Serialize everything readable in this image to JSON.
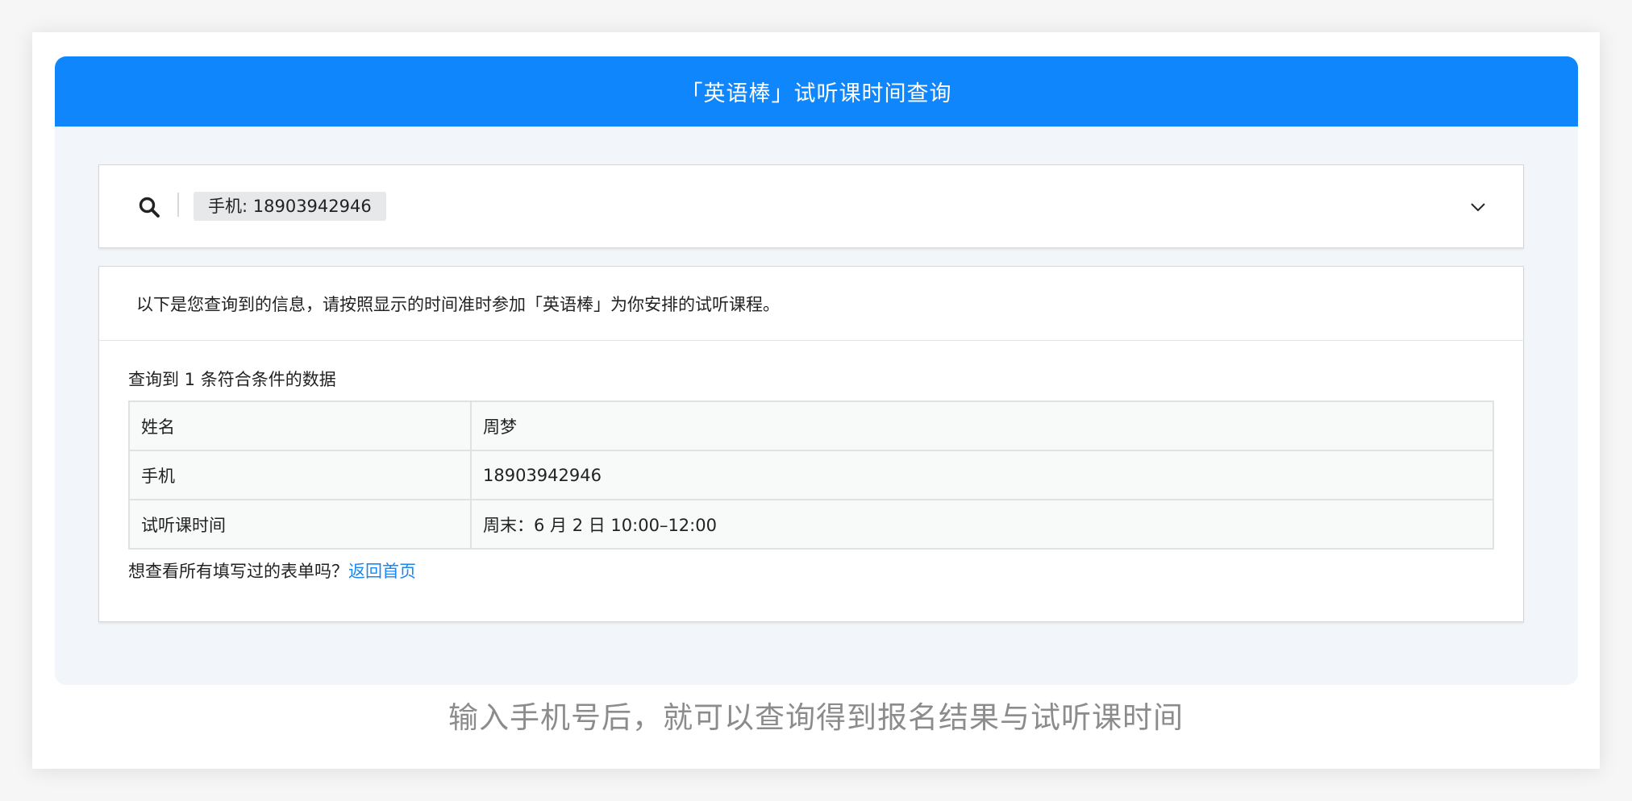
{
  "header": {
    "title": "「英语棒」试听课时间查询"
  },
  "search": {
    "tag_label": "手机: 18903942946"
  },
  "result": {
    "notice": "以下是您查询到的信息，请按照显示的时间准时参加「英语棒」为你安排的试听课程。",
    "count_text": "查询到 1 条符合条件的数据",
    "rows": [
      {
        "label": "姓名",
        "value": "周梦"
      },
      {
        "label": "手机",
        "value": "18903942946"
      },
      {
        "label": "试听课时间",
        "value": "周末：6 月 2 日 10:00–12:00"
      }
    ],
    "footer_text": "想查看所有填写过的表单吗？",
    "home_link": "返回首页"
  },
  "caption": "输入手机号后，就可以查询得到报名结果与试听课时间",
  "colors": {
    "header_bg": "#0f86fb",
    "link": "#1a87f0"
  },
  "icons": [
    "search-icon",
    "chevron-down-icon"
  ]
}
